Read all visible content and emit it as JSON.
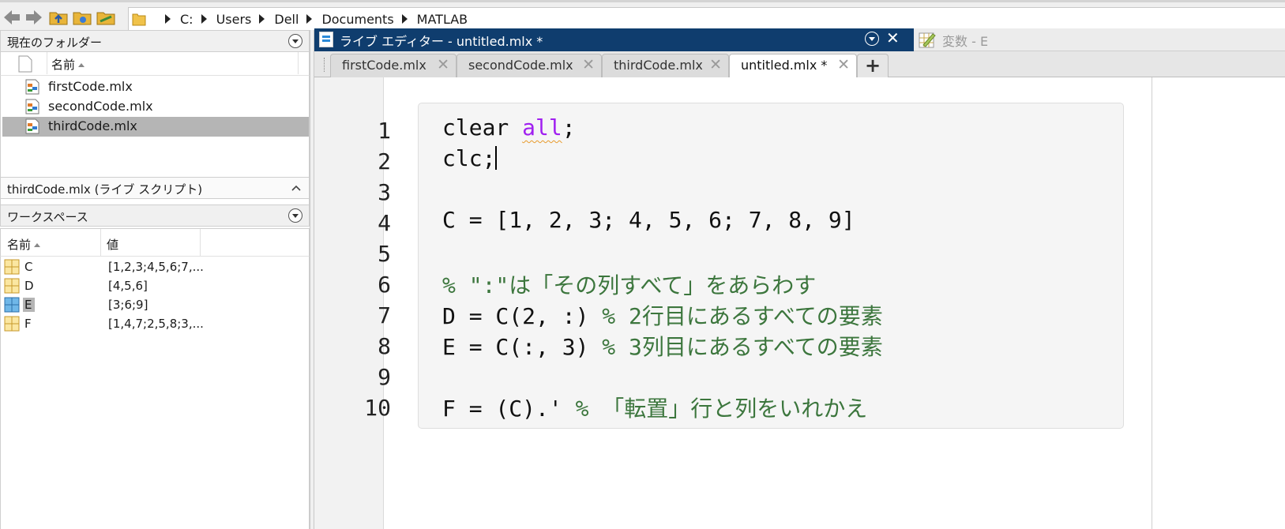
{
  "address_bar": {
    "crumbs": [
      "C:",
      "Users",
      "Dell",
      "Documents",
      "MATLAB"
    ]
  },
  "current_folder": {
    "title": "現在のフォルダー",
    "col_name": "名前",
    "files": [
      {
        "name": "firstCode.mlx",
        "selected": false
      },
      {
        "name": "secondCode.mlx",
        "selected": false
      },
      {
        "name": "thirdCode.mlx",
        "selected": true
      }
    ],
    "details": "thirdCode.mlx  (ライブ スクリプト)"
  },
  "workspace": {
    "title": "ワークスペース",
    "col_name": "名前",
    "col_value": "値",
    "vars": [
      {
        "name": "C",
        "value": "[1,2,3;4,5,6;7,..."
      },
      {
        "name": "D",
        "value": "[4,5,6]"
      },
      {
        "name": "E",
        "value": "[3;6;9]"
      },
      {
        "name": "F",
        "value": "[1,4,7;2,5,8;3,..."
      }
    ]
  },
  "editor": {
    "title": "ライブ エディター - untitled.mlx *",
    "variables_tab": "変数 - E",
    "tabs": [
      {
        "label": "firstCode.mlx"
      },
      {
        "label": "secondCode.mlx"
      },
      {
        "label": "thirdCode.mlx"
      },
      {
        "label": "untitled.mlx *"
      }
    ],
    "add_tab": "+",
    "lines": [
      {
        "num": "1",
        "code": "clear ",
        "kw": "all",
        "tail": ";"
      },
      {
        "num": "2",
        "code": "clc;"
      },
      {
        "num": "3",
        "code": ""
      },
      {
        "num": "4",
        "code": "C = [1, 2, 3; 4, 5, 6; 7, 8, 9]"
      },
      {
        "num": "5",
        "code": ""
      },
      {
        "num": "6",
        "code": "",
        "comment_mono": "% \":\"",
        "comment": "は「その列すべて」をあらわす"
      },
      {
        "num": "7",
        "code": "D = C(2, :) ",
        "comment_mono": "% 2",
        "comment": "行目にあるすべての要素"
      },
      {
        "num": "8",
        "code": "E = C(:, 3) ",
        "comment_mono": "% 3",
        "comment": "列目にあるすべての要素"
      },
      {
        "num": "9",
        "code": ""
      },
      {
        "num": "10",
        "code": "F = (C).' ",
        "comment_mono": "% ",
        "comment": "「転置」行と列をいれかえ"
      }
    ]
  },
  "colors": {
    "title_bar": "#0f3d6e",
    "keyword": "#a020f0",
    "comment": "#3c763d",
    "selection": "#b5b5b5"
  }
}
